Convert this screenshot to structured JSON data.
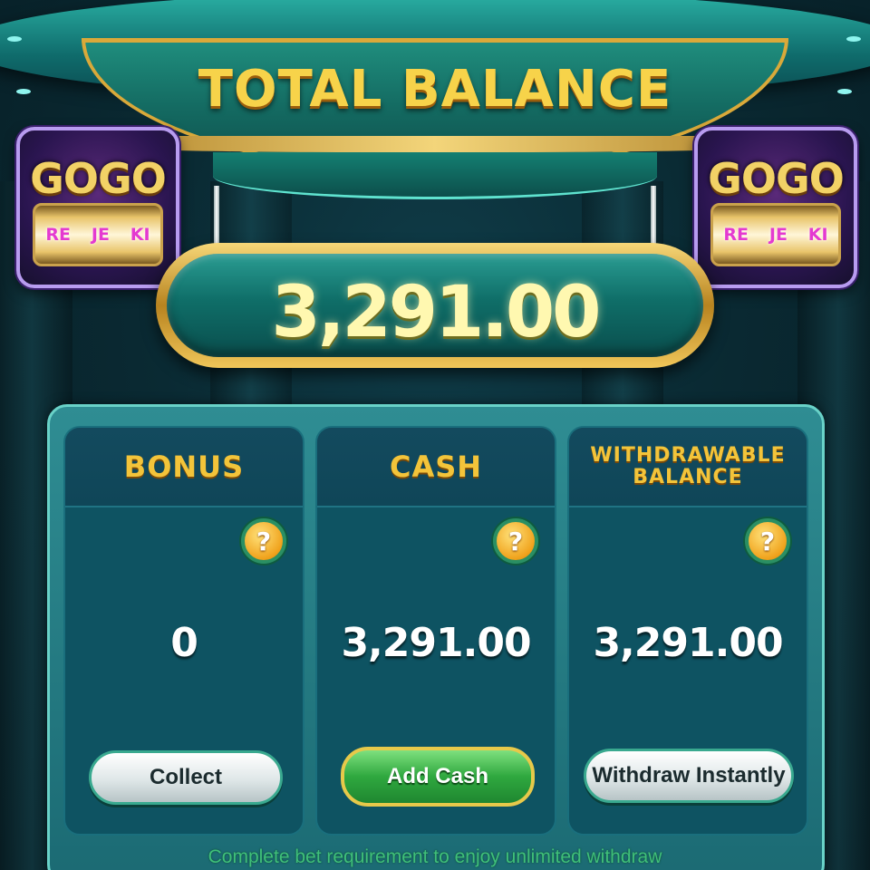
{
  "header": {
    "title": "TOTAL BALANCE"
  },
  "logos": {
    "left": {
      "word": "GOGO",
      "reels": [
        "RE",
        "JE",
        "KI"
      ]
    },
    "right": {
      "word": "GOGO",
      "reels": [
        "RE",
        "JE",
        "KI"
      ]
    }
  },
  "total": {
    "value": "3,291.00"
  },
  "cards": [
    {
      "title": "BONUS",
      "value": "0",
      "button": "Collect"
    },
    {
      "title": "CASH",
      "value": "3,291.00",
      "button": "Add Cash"
    },
    {
      "title_line1": "WITHDRAWABLE",
      "title_line2": "BALANCE",
      "value": "3,291.00",
      "button": "Withdraw Instantly"
    }
  ],
  "help_glyph": "?",
  "footer": {
    "note": "Complete bet requirement to enjoy unlimited withdraw"
  },
  "colors": {
    "gold": "#f3c43a",
    "teal": "#0e5362",
    "accent_green": "#2fa83f"
  }
}
